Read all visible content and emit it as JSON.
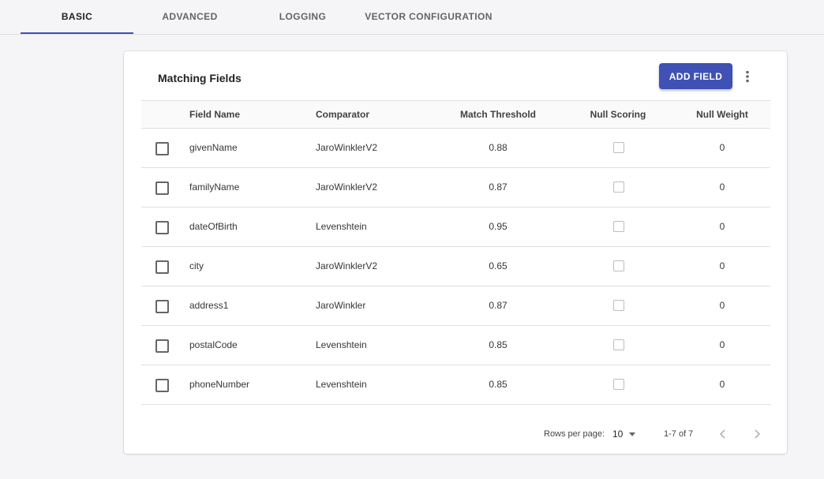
{
  "tabs": [
    {
      "label": "BASIC",
      "active": true
    },
    {
      "label": "ADVANCED",
      "active": false
    },
    {
      "label": "LOGGING",
      "active": false
    },
    {
      "label": "VECTOR CONFIGURATION",
      "active": false
    }
  ],
  "card": {
    "title": "Matching Fields",
    "add_button_label": "ADD FIELD",
    "more_icon": "more-vert-icon"
  },
  "table": {
    "headers": {
      "field_name": "Field Name",
      "comparator": "Comparator",
      "match_threshold": "Match Threshold",
      "null_scoring": "Null Scoring",
      "null_weight": "Null Weight"
    },
    "rows": [
      {
        "field_name": "givenName",
        "comparator": "JaroWinklerV2",
        "match_threshold": "0.88",
        "null_scoring": false,
        "null_weight": "0"
      },
      {
        "field_name": "familyName",
        "comparator": "JaroWinklerV2",
        "match_threshold": "0.87",
        "null_scoring": false,
        "null_weight": "0"
      },
      {
        "field_name": "dateOfBirth",
        "comparator": "Levenshtein",
        "match_threshold": "0.95",
        "null_scoring": false,
        "null_weight": "0"
      },
      {
        "field_name": "city",
        "comparator": "JaroWinklerV2",
        "match_threshold": "0.65",
        "null_scoring": false,
        "null_weight": "0"
      },
      {
        "field_name": "address1",
        "comparator": "JaroWinkler",
        "match_threshold": "0.87",
        "null_scoring": false,
        "null_weight": "0"
      },
      {
        "field_name": "postalCode",
        "comparator": "Levenshtein",
        "match_threshold": "0.85",
        "null_scoring": false,
        "null_weight": "0"
      },
      {
        "field_name": "phoneNumber",
        "comparator": "Levenshtein",
        "match_threshold": "0.85",
        "null_scoring": false,
        "null_weight": "0"
      }
    ]
  },
  "pagination": {
    "rows_per_page_label": "Rows per page:",
    "rows_per_page_value": "10",
    "range_text": "1-7 of 7",
    "prev_icon": "chevron-left-icon",
    "next_icon": "chevron-right-icon"
  },
  "colors": {
    "accent": "#3f51b5",
    "background": "#f5f5f8"
  }
}
